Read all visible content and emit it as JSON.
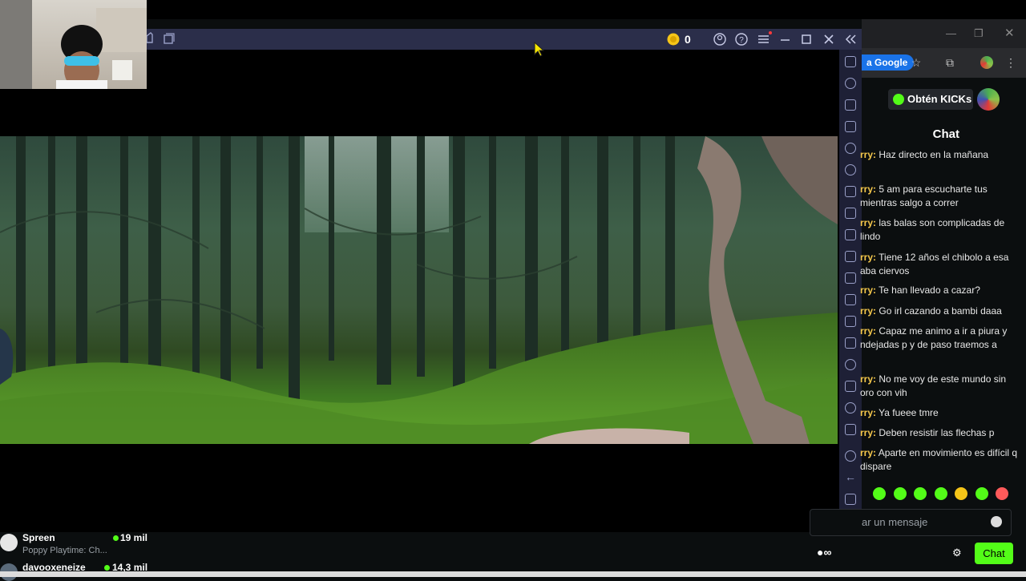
{
  "emulator": {
    "coins": "0"
  },
  "browser": {
    "google_chip": "a Google"
  },
  "chat": {
    "get_kicks_label": "Obtén KICKs",
    "title": "Chat",
    "messages": [
      {
        "user": "rry:",
        "text": "Haz directo en la mañana"
      },
      {
        "user": "rry:",
        "text": "5 am para escucharte tus mientras salgo a correr"
      },
      {
        "user": "rry:",
        "text": "las balas son complicadas de lindo"
      },
      {
        "user": "rry:",
        "text": "Tiene 12 años el chibolo a esa aba ciervos"
      },
      {
        "user": "rry:",
        "text": "Te han llevado a cazar?"
      },
      {
        "user": "rry:",
        "text": "Go irl cazando a bambi daaa"
      },
      {
        "user": "rry:",
        "text": "Capaz me animo a ir a piura y ndejadas p y de paso traemos a"
      },
      {
        "user": "rry:",
        "text": "No me voy de este mundo sin oro con vih"
      },
      {
        "user": "rry:",
        "text": "Ya fueee tmre"
      },
      {
        "user": "rry:",
        "text": "Deben resistir las flechas p"
      },
      {
        "user": "rry:",
        "text": "Aparte en movimiento es difícil q dispare"
      }
    ],
    "input_placeholder": "ar un mensaje",
    "send_label": "Chat"
  },
  "channels": [
    {
      "name": "Spreen",
      "subtitle": "Poppy Playtime: Ch...",
      "viewers": "19 mil"
    },
    {
      "name": "davooxeneize",
      "subtitle": "",
      "viewers": "14,3 mil"
    }
  ],
  "colors": {
    "kick_green": "#53fc18",
    "emulator_bar": "#2b2e4a",
    "username": "#f5c84c"
  }
}
